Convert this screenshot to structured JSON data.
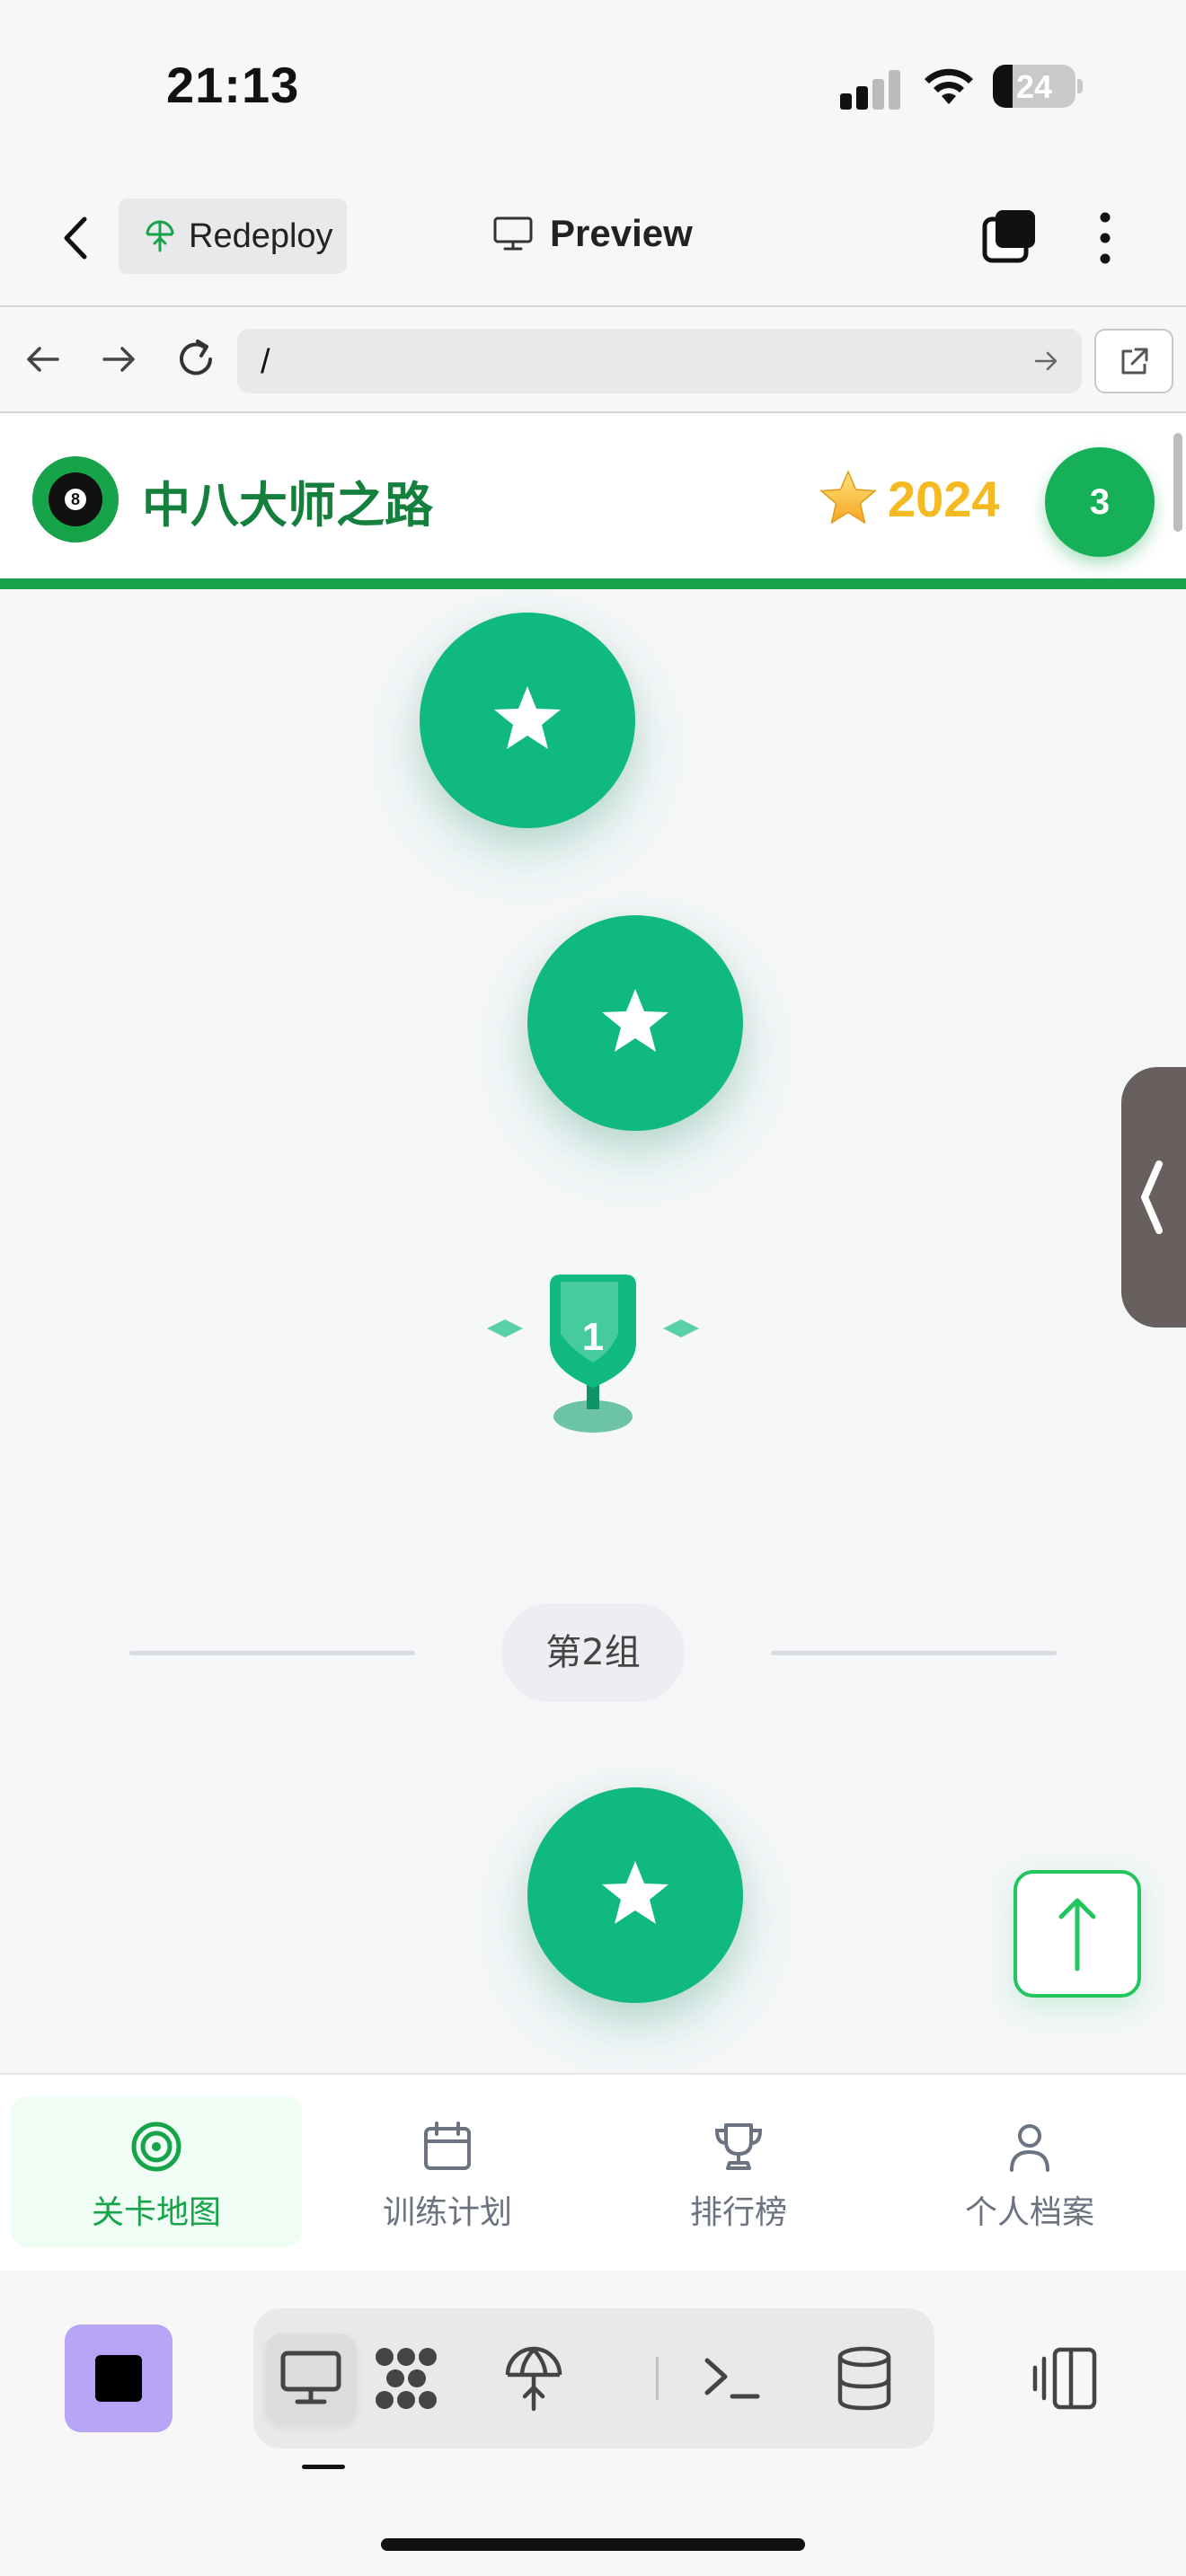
{
  "status_bar": {
    "time": "21:13",
    "battery": "24"
  },
  "app_toolbar": {
    "redeploy_label": "Redeploy",
    "preview_label": "Preview"
  },
  "browser": {
    "url": "/"
  },
  "app_header": {
    "title": "中八大师之路",
    "stars": "2024",
    "level": "3",
    "logo_number": "8"
  },
  "map": {
    "trophy_number": "1",
    "group_label": "第2组"
  },
  "bottom_nav": {
    "items": [
      {
        "label": "关卡地图",
        "icon": "target-icon",
        "active": true
      },
      {
        "label": "训练计划",
        "icon": "calendar-icon",
        "active": false
      },
      {
        "label": "排行榜",
        "icon": "trophy-icon",
        "active": false
      },
      {
        "label": "个人档案",
        "icon": "user-icon",
        "active": false
      }
    ]
  },
  "colors": {
    "brand_green": "#16a34a",
    "node_green": "#10b981",
    "star_gold": "#f5b921",
    "stop_purple": "#b7a4f7"
  }
}
